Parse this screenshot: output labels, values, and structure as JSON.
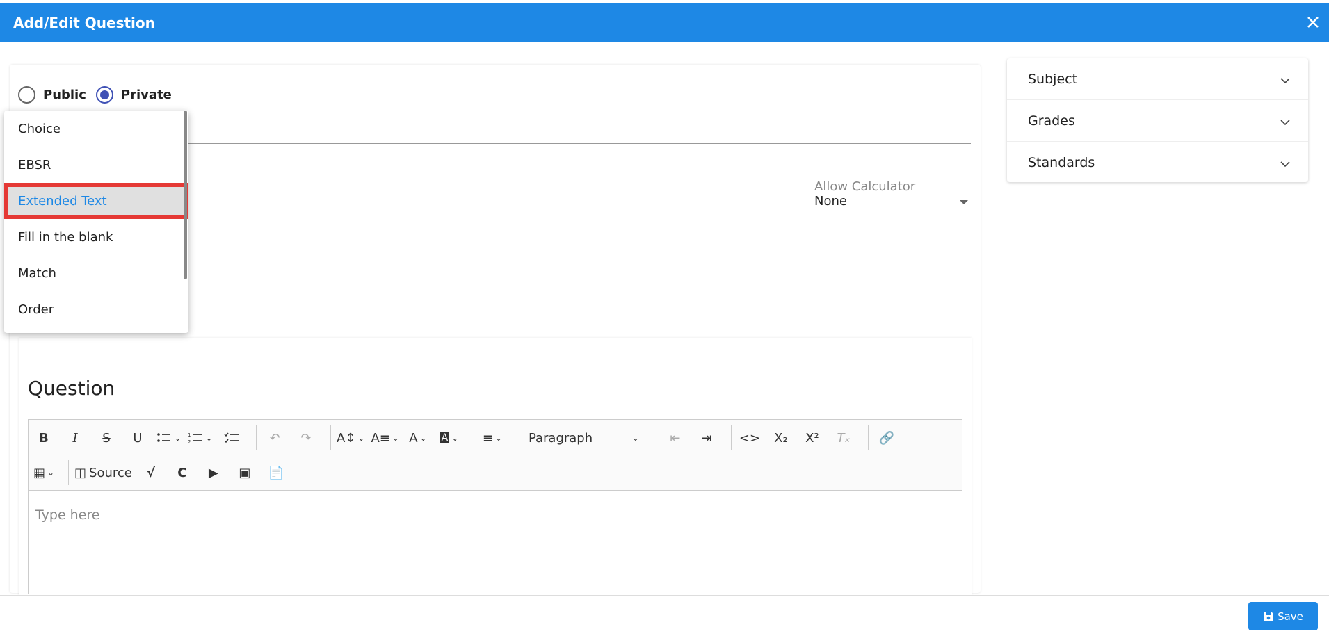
{
  "header": {
    "title": "Add/Edit Question"
  },
  "visibility": {
    "public_label": "Public",
    "private_label": "Private",
    "selected": "Private"
  },
  "question_type_dropdown": {
    "items": [
      "Choice",
      "EBSR",
      "Extended Text",
      "Fill in the blank",
      "Match",
      "Order"
    ],
    "selected": "Extended Text"
  },
  "calculator": {
    "label": "Allow Calculator",
    "value": "None"
  },
  "question_section": {
    "title": "Question",
    "toolbar": {
      "source_label": "Source",
      "paragraph_label": "Paragraph"
    },
    "editor_placeholder": "Type here"
  },
  "side_panel": {
    "items": [
      "Subject",
      "Grades",
      "Standards"
    ]
  },
  "footer": {
    "save_label": "Save"
  },
  "colors": {
    "accent": "#1e88e5",
    "highlight_border": "#e53935",
    "radio": "#3f51b5"
  }
}
